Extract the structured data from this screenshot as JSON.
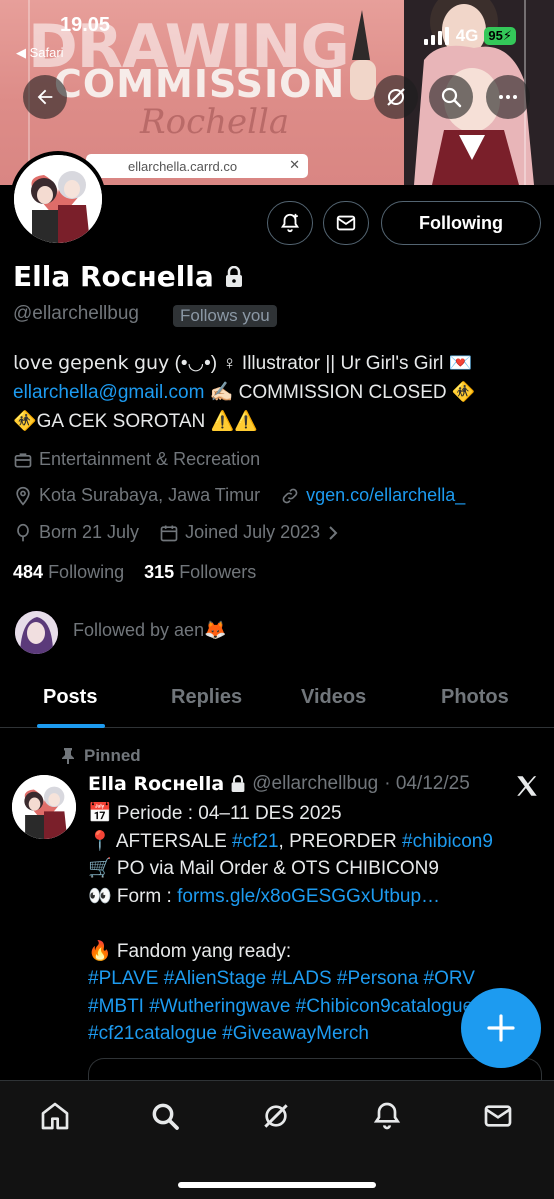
{
  "status_bar": {
    "time": "19.05",
    "back_app": "◀ Safari",
    "network": "4G",
    "battery": "95"
  },
  "banner": {
    "title_line1": "DRAWING",
    "title_line2": "COMMISSION",
    "title_line3": "Rochella",
    "url": "ellarchella.carrd.co"
  },
  "actions": {
    "following_label": "Following"
  },
  "profile": {
    "display_name": "Ella Rocнella",
    "handle": "@ellarchellbug",
    "follows_you": "Follows you",
    "bio_line1": "𝗅𝗈𝗏𝖾 𝗀𝖾𝗉𝖾𝗇𝗄 𝗀𝗎𝗒 (•◡•) ♀ Illustrator || Ur Girl's Girl 💌",
    "bio_email": "ellarchella@gmail.com",
    "bio_line2_rest": " ✍🏻 COMMISSION CLOSED 🚸",
    "bio_line3": "🚸GA CEK SOROTAN ⚠️⚠️",
    "category": "Entertainment & Recreation",
    "location": "Kota Surabaya, Jawa Timur",
    "website": "vgen.co/ellarchella_",
    "born": "Born 21 July",
    "joined": "Joined July 2023",
    "following_count": "484",
    "following_label": "Following",
    "followers_count": "315",
    "followers_label": "Followers",
    "followed_by": "Followed by aen🦊"
  },
  "tabs": {
    "posts": "Posts",
    "replies": "Replies",
    "videos": "Videos",
    "photos": "Photos"
  },
  "pinned_post": {
    "pinned_label": "Pinned",
    "author_name": "Ella Rocнella",
    "author_handle": "@ellarchellbug",
    "date": "· 04/12/25",
    "line1": "📅 Periode : 04–11 DES 2025",
    "line2_prefix": "📍 AFTERSALE ",
    "line2_tag1": "#cf21",
    "line2_mid": ", PREORDER ",
    "line2_tag2": "#chibicon9",
    "line3": "🛒 PO via Mail Order & OTS CHIBICON9",
    "line4_prefix": "👀 Form : ",
    "line4_link": "forms.gle/x8oGESGGxUtbup…",
    "line5": "🔥 Fandom yang ready:",
    "tags_line1": "#PLAVE #AlienStage #LADS #Persona #ORV",
    "tags_line2": "#MBTI #Wutheringwave #Chibicon9catalogue",
    "tags_line3": "#cf21catalogue #GiveawayMerch"
  },
  "colors": {
    "accent": "#1d9bf0",
    "muted": "#71767b",
    "background": "#000000"
  },
  "nav": [
    "home-icon",
    "search-icon",
    "grok-icon",
    "notifications-icon",
    "messages-icon"
  ]
}
